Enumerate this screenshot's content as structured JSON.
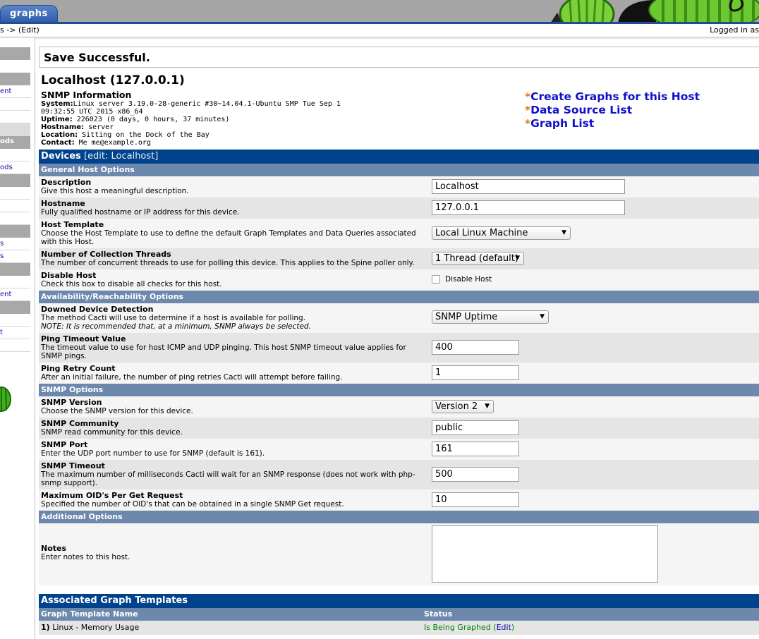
{
  "header": {
    "tab_label": "graphs",
    "breadcrumb_tail": "s -> (Edit)",
    "login_status": "Logged in as"
  },
  "sidebar": {
    "items": [
      "ent",
      "ods",
      "ods",
      "s",
      "s",
      "ent",
      "t"
    ]
  },
  "message": "Save Successful.",
  "host": {
    "title": "Localhost (127.0.0.1)",
    "snmp_title": "SNMP Information",
    "system_label": "System:",
    "system_value": "Linux server 3.19.0-28-generic #30~14.04.1-Ubuntu SMP Tue Sep 1 09:32:55 UTC 2015 x86_64",
    "uptime_label": "Uptime:",
    "uptime_value": " 226023 (0 days, 0 hours, 37 minutes)",
    "hostname_label": "Hostname:",
    "hostname_value": " server",
    "location_label": "Location:",
    "location_value": " Sitting on the Dock of the Bay",
    "contact_label": "Contact:",
    "contact_value": " Me me@example.org"
  },
  "quick_links": [
    "Create Graphs for this Host",
    "Data Source List",
    "Graph List"
  ],
  "devices_header": {
    "title": "Devices",
    "sub": "[edit: Localhost]"
  },
  "sections": {
    "general": "General Host Options",
    "availability": "Availability/Reachability Options",
    "snmp": "SNMP Options",
    "additional": "Additional Options"
  },
  "fields": {
    "description": {
      "title": "Description",
      "desc": "Give this host a meaningful description.",
      "value": "Localhost"
    },
    "hostname": {
      "title": "Hostname",
      "desc": "Fully qualified hostname or IP address for this device.",
      "value": "127.0.0.1"
    },
    "host_template": {
      "title": "Host Template",
      "desc": "Choose the Host Template to use to define the default Graph Templates and Data Queries associated with this Host.",
      "value": "Local Linux Machine"
    },
    "threads": {
      "title": "Number of Collection Threads",
      "desc": "The number of concurrent threads to use for polling this device. This applies to the Spine poller only.",
      "value": "1 Thread (default)"
    },
    "disable": {
      "title": "Disable Host",
      "desc": "Check this box to disable all checks for this host.",
      "checkbox_label": "Disable Host"
    },
    "downed": {
      "title": "Downed Device Detection",
      "desc": "The method Cacti will use to determine if a host is available for polling.",
      "note": "NOTE: It is recommended that, at a minimum, SNMP always be selected.",
      "value": "SNMP Uptime"
    },
    "ping_timeout": {
      "title": "Ping Timeout Value",
      "desc": "The timeout value to use for host ICMP and UDP pinging. This host SNMP timeout value applies for SNMP pings.",
      "value": "400"
    },
    "ping_retry": {
      "title": "Ping Retry Count",
      "desc": "After an initial failure, the number of ping retries Cacti will attempt before failing.",
      "value": "1"
    },
    "snmp_version": {
      "title": "SNMP Version",
      "desc": "Choose the SNMP version for this device.",
      "value": "Version 2"
    },
    "snmp_community": {
      "title": "SNMP Community",
      "desc": "SNMP read community for this device.",
      "value": "public"
    },
    "snmp_port": {
      "title": "SNMP Port",
      "desc": "Enter the UDP port number to use for SNMP (default is 161).",
      "value": "161"
    },
    "snmp_timeout": {
      "title": "SNMP Timeout",
      "desc": "The maximum number of milliseconds Cacti will wait for an SNMP response (does not work with php-snmp support).",
      "value": "500"
    },
    "max_oids": {
      "title": "Maximum OID's Per Get Request",
      "desc": "Specified the number of OID's that can be obtained in a single SNMP Get request.",
      "value": "10"
    },
    "notes": {
      "title": "Notes",
      "desc": "Enter notes to this host.",
      "value": ""
    }
  },
  "graph_templates": {
    "title": "Associated Graph Templates",
    "col_name": "Graph Template Name",
    "col_status": "Status",
    "rows": [
      {
        "index": "1)",
        "name": "Linux - Memory Usage",
        "status": "Is Being Graphed",
        "open": "(",
        "action": "Edit",
        "close": ")"
      }
    ]
  },
  "colors": {
    "header_blue": "#00438c",
    "section_blue": "#6d88ad",
    "link_blue": "#1010aa",
    "star_orange": "#e07a00",
    "status_green": "#008000"
  }
}
